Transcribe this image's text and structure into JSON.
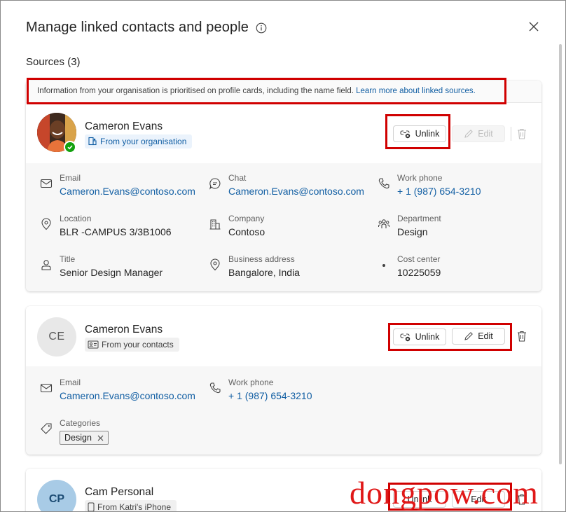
{
  "dialog": {
    "title": "Manage linked contacts and people",
    "sources_heading": "Sources (3)"
  },
  "notice": {
    "text": "Information from your organisation is prioritised on profile cards, including the name field.",
    "link": "Learn more about linked sources."
  },
  "cards": [
    {
      "name": "Cameron Evans",
      "source": "From your organisation",
      "unlink_label": "Unlink",
      "edit_label": "Edit",
      "fields": {
        "email": {
          "label": "Email",
          "value": "Cameron.Evans@contoso.com"
        },
        "chat": {
          "label": "Chat",
          "value": "Cameron.Evans@contoso.com"
        },
        "work_phone": {
          "label": "Work phone",
          "value": "+ 1 (987) 654-3210"
        },
        "location": {
          "label": "Location",
          "value": "BLR -CAMPUS 3/3B1006"
        },
        "company": {
          "label": "Company",
          "value": "Contoso"
        },
        "department": {
          "label": "Department",
          "value": "Design"
        },
        "title": {
          "label": "Title",
          "value": "Senior Design Manager"
        },
        "business_address": {
          "label": "Business address",
          "value": "Bangalore, India"
        },
        "cost_center": {
          "label": "Cost  center",
          "value": "10225059"
        }
      }
    },
    {
      "name": "Cameron Evans",
      "initials": "CE",
      "source": "From your contacts",
      "unlink_label": "Unlink",
      "edit_label": "Edit",
      "fields": {
        "email": {
          "label": "Email",
          "value": "Cameron.Evans@contoso.com"
        },
        "work_phone": {
          "label": "Work phone",
          "value": "+ 1 (987) 654-3210"
        },
        "categories": {
          "label": "Categories",
          "value": "Design"
        }
      }
    },
    {
      "name": "Cam Personal",
      "initials": "CP",
      "source": "From Katri's iPhone",
      "unlink_label": "Unlink",
      "edit_label": "Edit"
    }
  ],
  "watermark": "dongpow.com",
  "colors": {
    "link": "#115ea3",
    "highlight": "#d00000",
    "presence": "#13a10e"
  }
}
